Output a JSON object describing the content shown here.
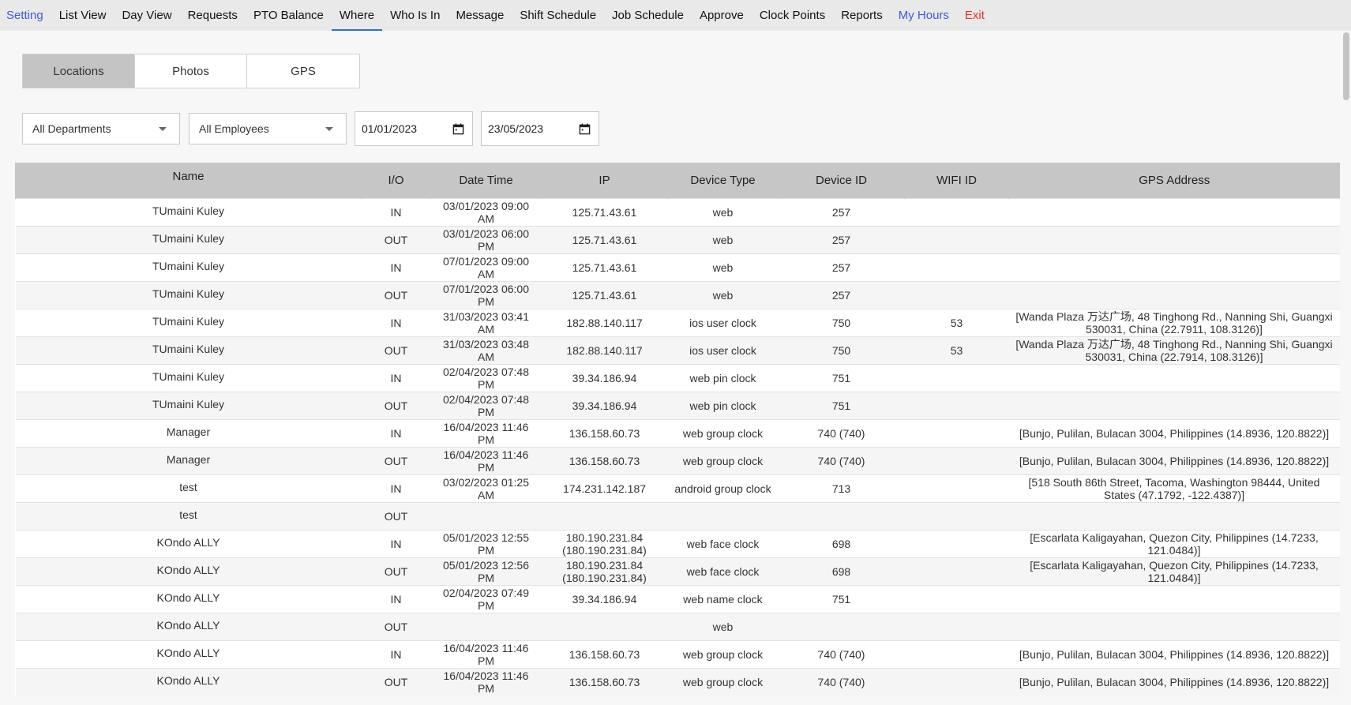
{
  "nav": [
    {
      "label": "Setting",
      "color": "#3b5bd6"
    },
    {
      "label": "List View",
      "color": "#111111"
    },
    {
      "label": "Day View",
      "color": "#111111"
    },
    {
      "label": "Requests",
      "color": "#111111"
    },
    {
      "label": "PTO Balance",
      "color": "#111111"
    },
    {
      "label": "Where",
      "color": "#111111",
      "active": true
    },
    {
      "label": "Who Is In",
      "color": "#111111"
    },
    {
      "label": "Message",
      "color": "#111111"
    },
    {
      "label": "Shift Schedule",
      "color": "#111111"
    },
    {
      "label": "Job Schedule",
      "color": "#111111"
    },
    {
      "label": "Approve",
      "color": "#111111"
    },
    {
      "label": "Clock Points",
      "color": "#111111"
    },
    {
      "label": "Reports",
      "color": "#111111"
    },
    {
      "label": "My Hours",
      "color": "#3b5bd6"
    },
    {
      "label": "Exit",
      "color": "#e0322b"
    }
  ],
  "subtabs": [
    {
      "label": "Locations",
      "active": true
    },
    {
      "label": "Photos",
      "active": false
    },
    {
      "label": "GPS",
      "active": false
    }
  ],
  "filters": {
    "department": "All Departments",
    "employee": "All Employees",
    "date_from": "01/01/2023",
    "date_to": "23/05/2023"
  },
  "table": {
    "headers": [
      "Name",
      "I/O",
      "Date Time",
      "IP",
      "Device Type",
      "Device ID",
      "WIFI ID",
      "GPS Address"
    ],
    "rows": [
      [
        "TUmaini Kuley",
        "IN",
        "03/01/2023 09:00 AM",
        "125.71.43.61",
        "web",
        "257",
        "",
        ""
      ],
      [
        "TUmaini Kuley",
        "OUT",
        "03/01/2023 06:00 PM",
        "125.71.43.61",
        "web",
        "257",
        "",
        ""
      ],
      [
        "TUmaini Kuley",
        "IN",
        "07/01/2023 09:00 AM",
        "125.71.43.61",
        "web",
        "257",
        "",
        ""
      ],
      [
        "TUmaini Kuley",
        "OUT",
        "07/01/2023 06:00 PM",
        "125.71.43.61",
        "web",
        "257",
        "",
        ""
      ],
      [
        "TUmaini Kuley",
        "IN",
        "31/03/2023 03:41 AM",
        "182.88.140.117",
        "ios user clock",
        "750",
        "53",
        "[Wanda Plaza 万达广场, 48 Tinghong Rd., Nanning Shi, Guangxi 530031, China (22.7911, 108.3126)]"
      ],
      [
        "TUmaini Kuley",
        "OUT",
        "31/03/2023 03:48 AM",
        "182.88.140.117",
        "ios user clock",
        "750",
        "53",
        "[Wanda Plaza 万达广场, 48 Tinghong Rd., Nanning Shi, Guangxi 530031, China (22.7914, 108.3126)]"
      ],
      [
        "TUmaini Kuley",
        "IN",
        "02/04/2023 07:48 PM",
        "39.34.186.94",
        "web pin clock",
        "751",
        "",
        ""
      ],
      [
        "TUmaini Kuley",
        "OUT",
        "02/04/2023 07:48 PM",
        "39.34.186.94",
        "web pin clock",
        "751",
        "",
        ""
      ],
      [
        "Manager",
        "IN",
        "16/04/2023 11:46 PM",
        "136.158.60.73",
        "web group clock",
        "740 (740)",
        "",
        "[Bunjo, Pulilan, Bulacan 3004, Philippines (14.8936, 120.8822)]"
      ],
      [
        "Manager",
        "OUT",
        "16/04/2023 11:46 PM",
        "136.158.60.73",
        "web group clock",
        "740 (740)",
        "",
        "[Bunjo, Pulilan, Bulacan 3004, Philippines (14.8936, 120.8822)]"
      ],
      [
        "test",
        "IN",
        "03/02/2023 01:25 AM",
        "174.231.142.187",
        "android group clock",
        "713",
        "",
        "[518 South 86th Street, Tacoma, Washington 98444, United States (47.1792, -122.4387)]"
      ],
      [
        "test",
        "OUT",
        "",
        "",
        "",
        "",
        "",
        ""
      ],
      [
        "KOndo ALLY",
        "IN",
        "05/01/2023 12:55 PM",
        "180.190.231.84 (180.190.231.84)",
        "web face clock",
        "698",
        "",
        "[Escarlata Kaligayahan, Quezon City, Philippines (14.7233, 121.0484)]"
      ],
      [
        "KOndo ALLY",
        "OUT",
        "05/01/2023 12:56 PM",
        "180.190.231.84 (180.190.231.84)",
        "web face clock",
        "698",
        "",
        "[Escarlata Kaligayahan, Quezon City, Philippines (14.7233, 121.0484)]"
      ],
      [
        "KOndo ALLY",
        "IN",
        "02/04/2023 07:49 PM",
        "39.34.186.94",
        "web name clock",
        "751",
        "",
        ""
      ],
      [
        "KOndo ALLY",
        "OUT",
        "",
        "",
        "web",
        "",
        "",
        ""
      ],
      [
        "KOndo ALLY",
        "IN",
        "16/04/2023 11:46 PM",
        "136.158.60.73",
        "web group clock",
        "740 (740)",
        "",
        "[Bunjo, Pulilan, Bulacan 3004, Philippines (14.8936, 120.8822)]"
      ],
      [
        "KOndo ALLY",
        "OUT",
        "16/04/2023 11:46 PM",
        "136.158.60.73",
        "web group clock",
        "740 (740)",
        "",
        "[Bunjo, Pulilan, Bulacan 3004, Philippines (14.8936, 120.8822)]"
      ]
    ]
  }
}
